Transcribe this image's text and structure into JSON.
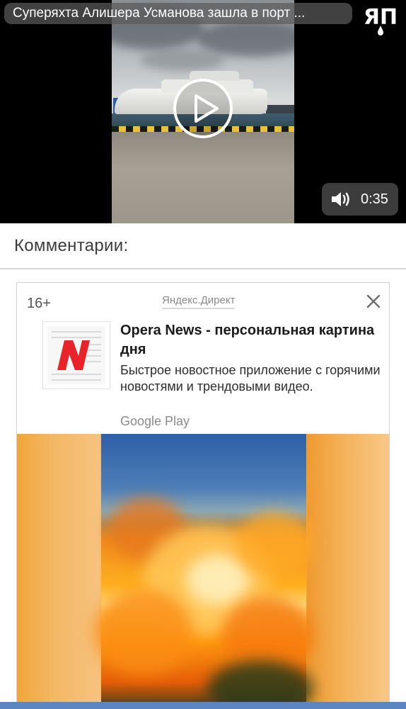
{
  "video": {
    "title": "Суперяхта Алишера Усманова зашла в порт ...",
    "logo_text": "ЯП",
    "duration": "0:35",
    "icons": {
      "play": "play-icon",
      "volume": "volume-icon"
    }
  },
  "comments": {
    "heading": "Комментарии:"
  },
  "ad": {
    "age_rating": "16+",
    "source": "Яндекс.Директ",
    "title": "Opera News - персональная картина дня",
    "description": "Быстрое новостное приложение с горячими новостями и трендовыми видео.",
    "store": "Google Play",
    "brand_color": "#e8232a",
    "icons": {
      "close": "close-icon",
      "app": "opera-news-logo"
    }
  }
}
